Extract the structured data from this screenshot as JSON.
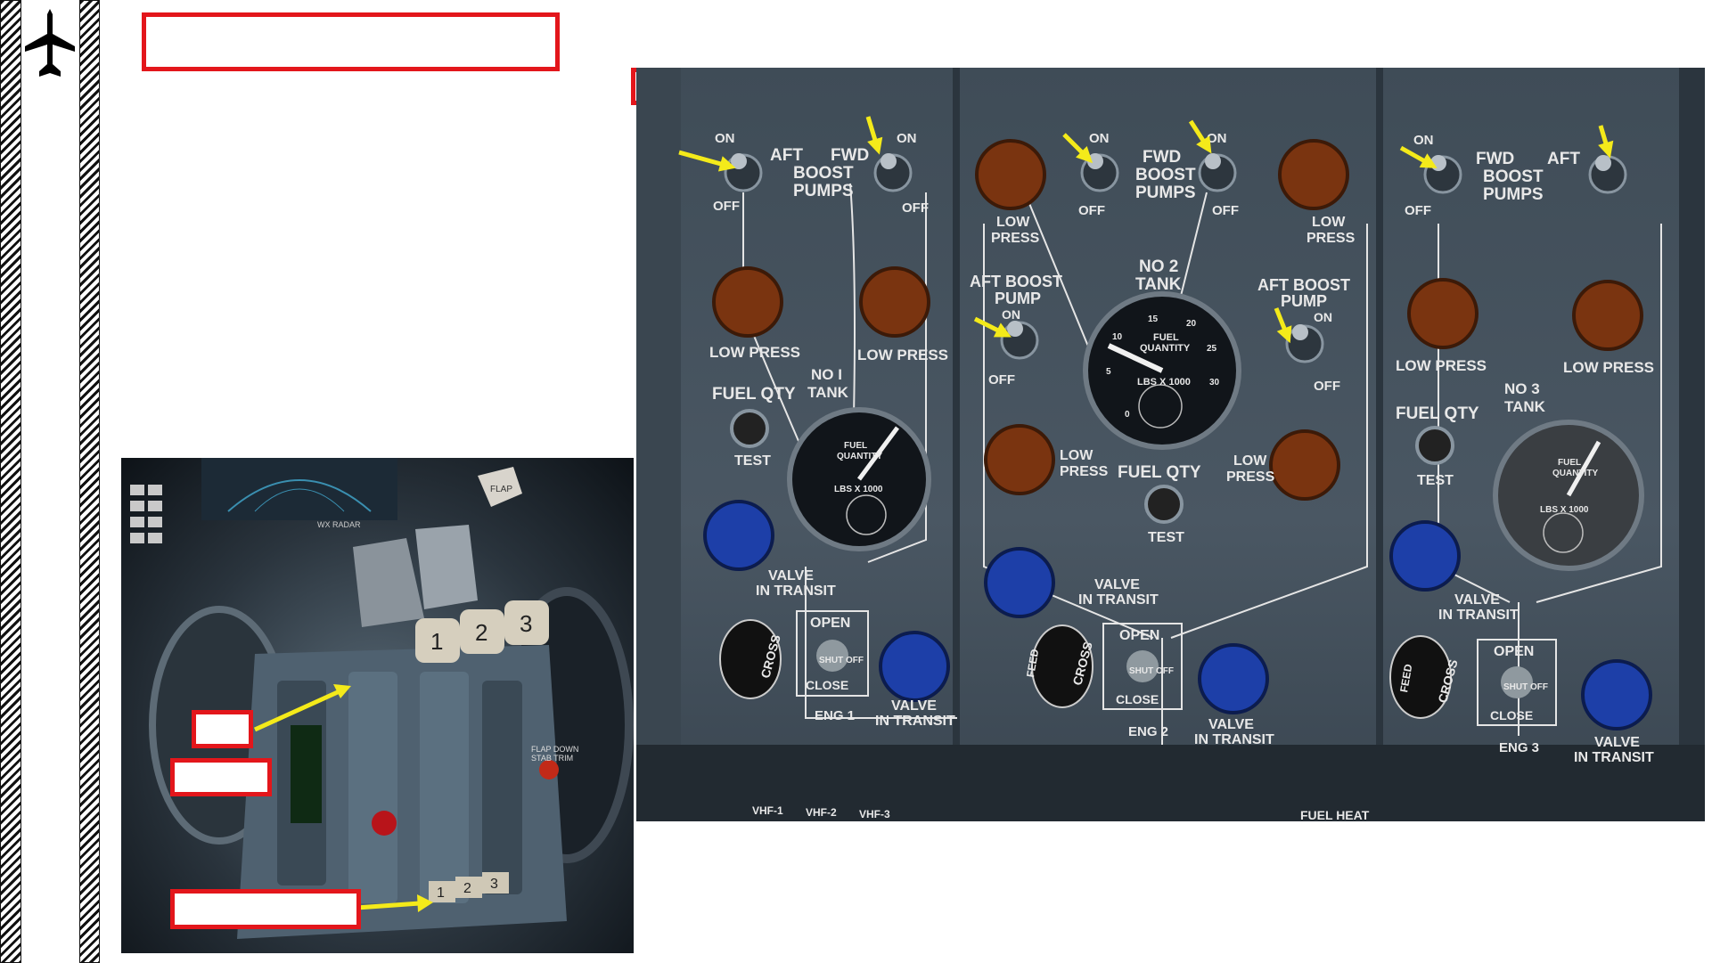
{
  "sidebar": {
    "logo_icon": "airplane-icon"
  },
  "colors": {
    "highlight_box": "#e3161b",
    "arrow": "#f4ea1a",
    "panel": "#44525e"
  },
  "throttle": {
    "lever_numbers": [
      "1",
      "2",
      "3"
    ],
    "small_numbers": [
      "1",
      "2",
      "3"
    ],
    "labels": {
      "flap": "FLAP",
      "wx_radar": "WX RADAR",
      "flap_down": "FLAP DOWN",
      "stab_trim": "STAB TRIM"
    }
  },
  "panel": {
    "section1": {
      "switch_on": "ON",
      "switch_off": "OFF",
      "aft_label": "AFT",
      "fwd_label": "FWD",
      "boost_pumps_1": "BOOST",
      "boost_pumps_2": "PUMPS",
      "low_press_left": "LOW PRESS",
      "low_press_right": "LOW PRESS",
      "tank_1": "NO I",
      "tank_2": "TANK",
      "fuel_qty": "FUEL QTY",
      "test": "TEST",
      "gauge_title_1": "FUEL",
      "gauge_title_2": "QUANTITY",
      "gauge_units": "LBS X 1000",
      "valve_1": "VALVE",
      "valve_2": "IN TRANSIT",
      "cross": "CROSS",
      "open": "OPEN",
      "shut_off": "SHUT OFF",
      "close": "CLOSE",
      "eng": "ENG 1",
      "valve_right_1": "VALVE",
      "valve_right_2": "IN TRANSIT"
    },
    "section2": {
      "switch_on": "ON",
      "switch_off": "OFF",
      "low_1": "LOW",
      "press_1": "PRESS",
      "low_2": "LOW",
      "press_2": "PRESS",
      "fwd_label": "FWD",
      "boost": "BOOST",
      "pumps": "PUMPS",
      "aft_boost_left_1": "AFT BOOST",
      "aft_boost_left_2": "PUMP",
      "aft_boost_right_1": "AFT BOOST",
      "aft_boost_right_2": "PUMP",
      "tank_1": "NO 2",
      "tank_2": "TANK",
      "gauge_title_1": "FUEL",
      "gauge_title_2": "QUANTITY",
      "gauge_units": "LBS X 1000",
      "gauge_ticks": [
        "0",
        "5",
        "10",
        "15",
        "20",
        "25",
        "30"
      ],
      "low_left_1": "LOW",
      "low_left_2": "PRESS",
      "low_right_1": "LOW",
      "low_right_2": "PRESS",
      "fuel_qty": "FUEL QTY",
      "test": "TEST",
      "valve_1": "VALVE",
      "valve_2": "IN TRANSIT",
      "feed": "FEED",
      "cross": "CROSS",
      "open": "OPEN",
      "shut_off": "SHUT OFF",
      "close": "CLOSE",
      "eng": "ENG 2",
      "valve_right_1": "VALVE",
      "valve_right_2": "IN TRANSIT"
    },
    "section3": {
      "switch_on": "ON",
      "switch_off": "OFF",
      "fwd_label": "FWD",
      "aft_label": "AFT",
      "boost": "BOOST",
      "pumps": "PUMPS",
      "low_press_left": "LOW PRESS",
      "low_press_right": "LOW PRESS",
      "tank_1": "NO 3",
      "tank_2": "TANK",
      "fuel_qty": "FUEL QTY",
      "test": "TEST",
      "gauge_title_1": "FUEL",
      "gauge_title_2": "QUANTITY",
      "gauge_units": "LBS X 1000",
      "valve_1": "VALVE",
      "valve_2": "IN TRANSIT",
      "feed": "FEED",
      "cross": "CROSS",
      "open": "OPEN",
      "shut_off": "SHUT OFF",
      "close": "CLOSE",
      "eng": "ENG 3",
      "valve_right_1": "VALVE",
      "valve_right_2": "IN TRANSIT"
    },
    "bottom": {
      "vhf1": "VHF-1",
      "vhf2": "VHF-2",
      "vhf3": "VHF-3",
      "fuel_heat": "FUEL HEAT"
    }
  }
}
